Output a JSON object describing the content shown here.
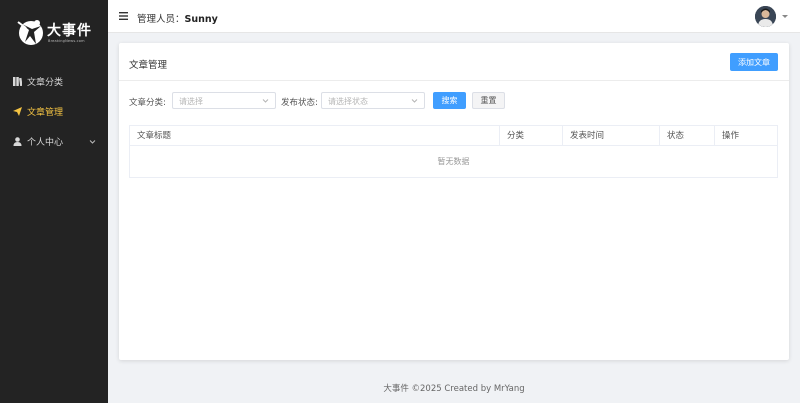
{
  "brand": {
    "name": "大事件",
    "subtitle": "BreakingNews.com"
  },
  "sidebar": {
    "items": [
      {
        "label": "文章分类",
        "icon": "category-icon",
        "active": false
      },
      {
        "label": "文章管理",
        "icon": "send-icon",
        "active": true
      },
      {
        "label": "个人中心",
        "icon": "user-icon",
        "active": false,
        "expandable": true
      }
    ]
  },
  "header": {
    "admin_prefix": "管理人员：",
    "admin_name": "Sunny"
  },
  "main": {
    "title": "文章管理",
    "add_button": "添加文章",
    "filter": {
      "category_label": "文章分类:",
      "category_placeholder": "请选择",
      "status_label": "发布状态:",
      "status_placeholder": "请选择状态",
      "search_button": "搜索",
      "reset_button": "重置"
    },
    "table": {
      "columns": [
        "文章标题",
        "分类",
        "发表时间",
        "状态",
        "操作"
      ],
      "empty_text": "暂无数据"
    }
  },
  "footer": {
    "text": "大事件 ©2025 Created by MrYang"
  },
  "colors": {
    "primary": "#409eff",
    "sidebar_bg": "#232323",
    "active": "#f5c443"
  }
}
